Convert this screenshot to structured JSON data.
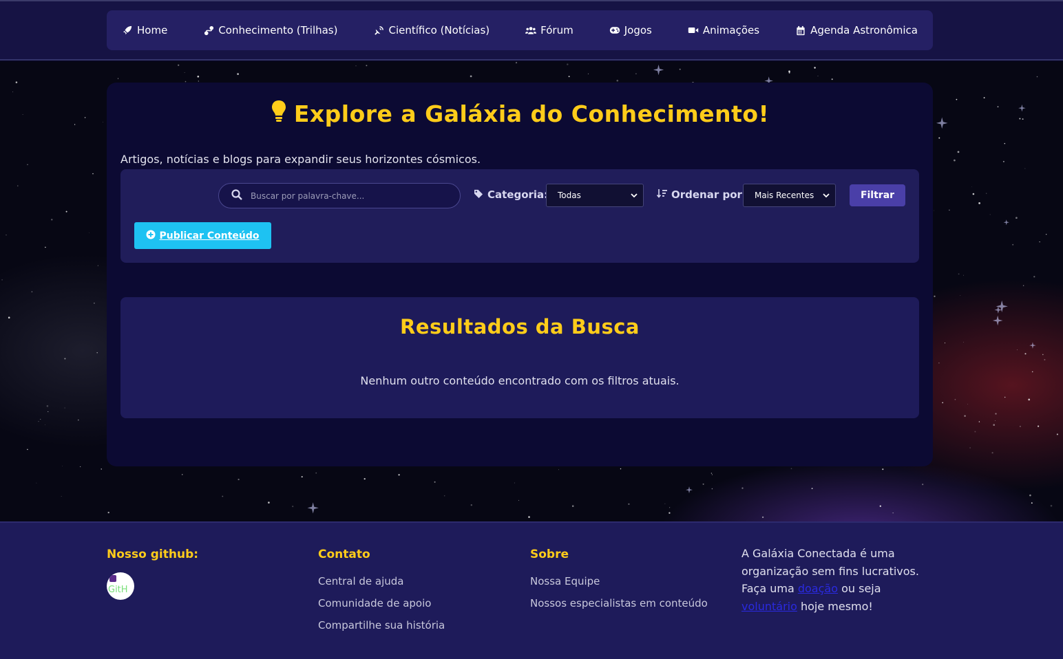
{
  "nav": {
    "items": [
      {
        "label": "Home",
        "icon": "rocket-icon"
      },
      {
        "label": "Conhecimento (Trilhas)",
        "icon": "route-icon"
      },
      {
        "label": "Científico (Notícias)",
        "icon": "satellite-dish-icon"
      },
      {
        "label": "Fórum",
        "icon": "users-icon"
      },
      {
        "label": "Jogos",
        "icon": "gamepad-icon"
      },
      {
        "label": "Animações",
        "icon": "video-icon"
      },
      {
        "label": "Agenda Astronômica",
        "icon": "calendar-icon"
      }
    ]
  },
  "main": {
    "title": "Explore a Galáxia do Conhecimento!",
    "subtitle": "Artigos, notícias e blogs para expandir seus horizontes cósmicos.",
    "search_placeholder": "Buscar por palavra-chave...",
    "category_label": "Categoria:",
    "category_value": "Todas",
    "sort_label": "Ordenar por:",
    "sort_value": "Mais Recentes",
    "filter_button": "Filtrar",
    "publish_button": "Publicar Conteúdo",
    "results_title": "Resultados da Busca",
    "results_empty": "Nenhum outro conteúdo encontrado com os filtros atuais."
  },
  "footer": {
    "github_title": "Nosso github:",
    "github_avatar_text": "GitH",
    "contact_title": "Contato",
    "contact_links": [
      "Central de ajuda",
      "Comunidade de apoio",
      "Compartilhe sua história"
    ],
    "about_title": "Sobre",
    "about_links": [
      "Nossa Equipe",
      "Nossos especialistas em conteúdo"
    ],
    "about_text_1": "A Galáxia Conectada é uma organização sem fins lucrativos. Faça uma",
    "about_link_1": "doação",
    "about_text_2": "ou seja",
    "about_link_2": "voluntário",
    "about_text_3": "hoje mesmo!"
  },
  "colors": {
    "accent_yellow": "#ffcc1a",
    "nav_bg": "#252064",
    "panel_bg": "#201d5a",
    "publish_blue": "#1ec2f2",
    "filter_purple": "#4a3fa8"
  }
}
